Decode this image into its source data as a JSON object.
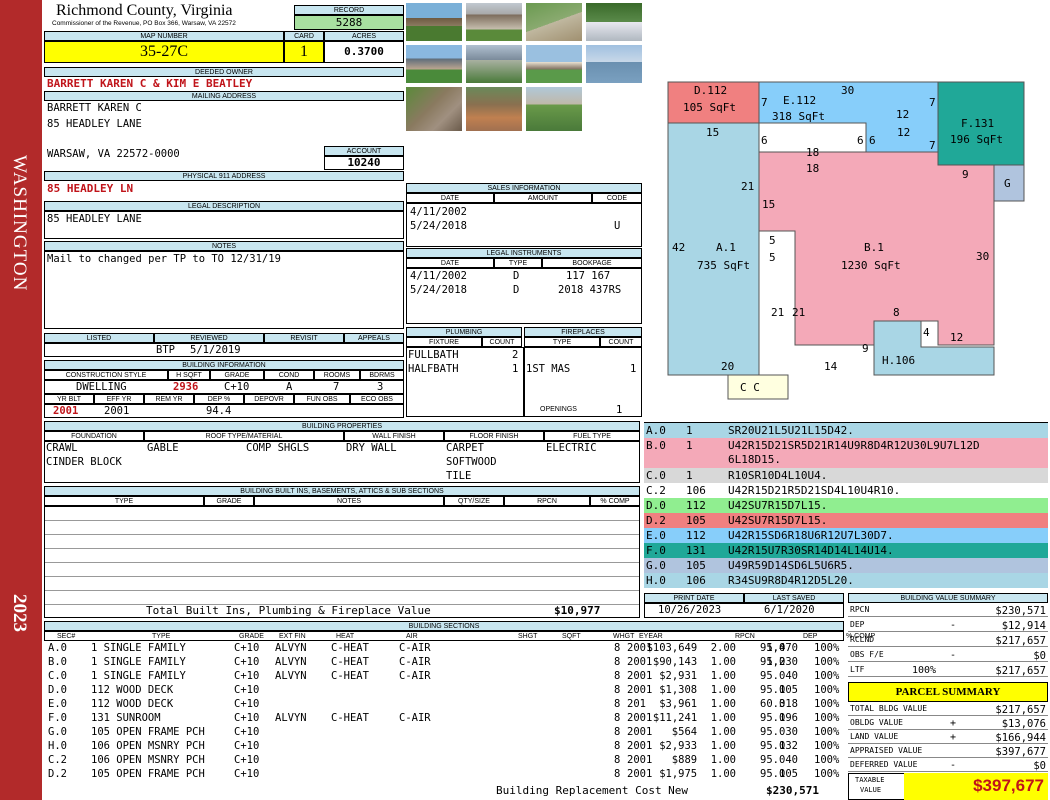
{
  "sidebar": {
    "top_label": "WASHINGTON",
    "bottom_label": "2023",
    "color": "#b22a2a"
  },
  "header": {
    "county": "Richmond County, Virginia",
    "commissioner": "Commissioner of the Revenue, PO Box 366, Warsaw, VA 22572",
    "record_label": "RECORD",
    "record": "5288",
    "map_number_label": "MAP NUMBER",
    "map_number": "35-27C",
    "card_label": "CARD",
    "card": "1",
    "acres_label": "ACRES",
    "acres": "0.3700"
  },
  "owner": {
    "deeded_owner_label": "DEEDED OWNER",
    "deeded_owner": "BARRETT KAREN C & KIM E BEATLEY",
    "mailing_label": "MAILING ADDRESS",
    "mail_line1": "BARRETT KAREN C",
    "mail_line2": "85 HEADLEY LANE",
    "mail_line3": "WARSAW, VA 22572-0000",
    "account_label": "ACCOUNT",
    "account": "10240",
    "physical_label": "PHYSICAL 911 ADDRESS",
    "physical": "85 HEADLEY LN",
    "legal_label": "LEGAL DESCRIPTION",
    "legal": "85 HEADLEY LANE",
    "notes_label": "NOTES",
    "notes": "Mail to changed per TP to TO 12/31/19"
  },
  "sales": {
    "title": "SALES INFORMATION",
    "col_date": "DATE",
    "col_amount": "AMOUNT",
    "col_code": "CODE",
    "rows": [
      {
        "date": "4/11/2002",
        "amount": "",
        "code": ""
      },
      {
        "date": "5/24/2018",
        "amount": "",
        "code": "U"
      }
    ]
  },
  "legal_instruments": {
    "title": "LEGAL INSTRUMENTS",
    "col_date": "DATE",
    "col_type": "TYPE",
    "col_book": "BOOKPAGE",
    "rows": [
      {
        "date": "4/11/2002",
        "type": "D",
        "book": "117 167"
      },
      {
        "date": "5/24/2018",
        "type": "D",
        "book": "2018 437RS"
      }
    ]
  },
  "plumbing": {
    "title": "PLUMBING",
    "col_fixture": "FIXTURE",
    "col_count": "COUNT",
    "rows": [
      {
        "fixture": "FULLBATH",
        "count": "2"
      },
      {
        "fixture": "HALFBATH",
        "count": "1"
      }
    ]
  },
  "fireplaces": {
    "title": "FIREPLACES",
    "col_type": "TYPE",
    "col_count": "COUNT",
    "rows": [
      {
        "type": "1ST MAS",
        "count": "1"
      }
    ],
    "openings_label": "OPENINGS",
    "openings": "1"
  },
  "review": {
    "listed_label": "LISTED",
    "reviewed_label": "REVIEWED",
    "revisit_label": "REVISIT",
    "appeals_label": "APPEALS",
    "listed": "",
    "reviewed_by": "BTP",
    "reviewed_date": "5/1/2019",
    "revisit": "",
    "appeals": ""
  },
  "building_info": {
    "title": "BUILDING INFORMATION",
    "labels": [
      "CONSTRUCTION STYLE",
      "H SQFT",
      "GRADE",
      "COND",
      "ROOMS",
      "BDRMS"
    ],
    "style": "DWELLING",
    "hsqft": "2936",
    "grade": "C+10",
    "cond": "A",
    "rooms": "7",
    "bdrms": "3",
    "labels2": [
      "YR BLT",
      "EFF YR",
      "REM YR",
      "DEP %",
      "DEPOVR",
      "FUN OBS",
      "ECO OBS"
    ],
    "yr_blt": "2001",
    "eff_yr": "2001",
    "rem_yr": "",
    "dep": "94.4",
    "depovr": "",
    "fun_obs": "",
    "eco_obs": ""
  },
  "properties": {
    "title": "BUILDING PROPERTIES",
    "labels": [
      "FOUNDATION",
      "ROOF TYPE/MATERIAL",
      "WALL FINISH",
      "FLOOR FINISH",
      "FUEL TYPE"
    ],
    "foundation": [
      "CRAWL",
      "CINDER BLOCK"
    ],
    "roof_type": "GABLE",
    "roof_material": "COMP SHGLS",
    "wall": "DRY WALL",
    "floor": [
      "CARPET",
      "SOFTWOOD",
      "TILE"
    ],
    "fuel": "ELECTRIC"
  },
  "builtins": {
    "title": "BUILDING BUILT INS, BASEMENTS, ATTICS & SUB SECTIONS",
    "labels": [
      "TYPE",
      "GRADE",
      "NOTES",
      "QTY/SIZE",
      "RPCN",
      "% COMP"
    ],
    "total_label": "Total Built Ins, Plumbing & Fireplace Value",
    "total": "$10,977"
  },
  "print": {
    "print_label": "PRINT DATE",
    "saved_label": "LAST SAVED",
    "print_date": "10/26/2023",
    "last_saved": "6/1/2020"
  },
  "sections": {
    "title": "BUILDING SECTIONS",
    "labels": [
      "SEC#",
      "TYPE",
      "GRADE",
      "EXT FIN",
      "HEAT",
      "AIR",
      "SHGT",
      "SQFT",
      "WHGT",
      "EYEAR",
      "RPCN",
      "DEP",
      "% COMP"
    ],
    "rows": [
      {
        "sec": "A.0",
        "type": "1 SINGLE FAMILY",
        "grade": "C+10",
        "ext": "ALVYN",
        "heat": "C-HEAT",
        "air": "C-AIR",
        "shgt": "2.00",
        "sqft": "1,470",
        "whgt": "8",
        "eyear": "2001",
        "rpcn": "$103,649",
        "dep": "95.0",
        "comp": "100%"
      },
      {
        "sec": "B.0",
        "type": "1 SINGLE FAMILY",
        "grade": "C+10",
        "ext": "ALVYN",
        "heat": "C-HEAT",
        "air": "C-AIR",
        "shgt": "1.00",
        "sqft": "1,230",
        "whgt": "8",
        "eyear": "2001",
        "rpcn": "$90,143",
        "dep": "95.0",
        "comp": "100%"
      },
      {
        "sec": "C.0",
        "type": "1 SINGLE FAMILY",
        "grade": "C+10",
        "ext": "ALVYN",
        "heat": "C-HEAT",
        "air": "C-AIR",
        "shgt": "1.00",
        "sqft": "40",
        "whgt": "8",
        "eyear": "2001",
        "rpcn": "$2,931",
        "dep": "95.0",
        "comp": "100%"
      },
      {
        "sec": "D.0",
        "type": "112 WOOD DECK",
        "grade": "C+10",
        "ext": "",
        "heat": "",
        "air": "",
        "shgt": "1.00",
        "sqft": "105",
        "whgt": "8",
        "eyear": "2001",
        "rpcn": "$1,308",
        "dep": "95.0",
        "comp": "100%"
      },
      {
        "sec": "E.0",
        "type": "112 WOOD DECK",
        "grade": "C+10",
        "ext": "",
        "heat": "",
        "air": "",
        "shgt": "1.00",
        "sqft": "318",
        "whgt": "8",
        "eyear": "201",
        "rpcn": "$3,961",
        "dep": "60.0",
        "comp": "100%"
      },
      {
        "sec": "F.0",
        "type": "131 SUNROOM",
        "grade": "C+10",
        "ext": "ALVYN",
        "heat": "C-HEAT",
        "air": "C-AIR",
        "shgt": "1.00",
        "sqft": "196",
        "whgt": "8",
        "eyear": "2001",
        "rpcn": "$11,241",
        "dep": "95.0",
        "comp": "100%"
      },
      {
        "sec": "G.0",
        "type": "105 OPEN FRAME PCH",
        "grade": "C+10",
        "ext": "",
        "heat": "",
        "air": "",
        "shgt": "1.00",
        "sqft": "30",
        "whgt": "8",
        "eyear": "2001",
        "rpcn": "$564",
        "dep": "95.0",
        "comp": "100%"
      },
      {
        "sec": "H.0",
        "type": "106 OPEN MSNRY PCH",
        "grade": "C+10",
        "ext": "",
        "heat": "",
        "air": "",
        "shgt": "1.00",
        "sqft": "132",
        "whgt": "8",
        "eyear": "2001",
        "rpcn": "$2,933",
        "dep": "95.0",
        "comp": "100%"
      },
      {
        "sec": "C.2",
        "type": "106 OPEN MSNRY PCH",
        "grade": "C+10",
        "ext": "",
        "heat": "",
        "air": "",
        "shgt": "1.00",
        "sqft": "40",
        "whgt": "8",
        "eyear": "2001",
        "rpcn": "$889",
        "dep": "95.0",
        "comp": "100%"
      },
      {
        "sec": "D.2",
        "type": "105 OPEN FRAME PCH",
        "grade": "C+10",
        "ext": "",
        "heat": "",
        "air": "",
        "shgt": "1.00",
        "sqft": "105",
        "whgt": "8",
        "eyear": "2001",
        "rpcn": "$1,975",
        "dep": "95.0",
        "comp": "100%"
      }
    ],
    "total_label": "Building Replacement Cost New",
    "total": "$230,571"
  },
  "sketch": {
    "labels": [
      {
        "id": "D.112",
        "sqft": "105 SqFt"
      },
      {
        "id": "E.112",
        "sqft": "318 SqFt"
      },
      {
        "id": "F.131",
        "sqft": "196 SqFt"
      },
      {
        "id": "G",
        "sqft": ""
      },
      {
        "id": "A.1",
        "sqft": "735 SqFt"
      },
      {
        "id": "B.1",
        "sqft": "1230 SqFt"
      },
      {
        "id": "H.106",
        "sqft": ""
      },
      {
        "id": "C C",
        "sqft": ""
      }
    ],
    "dims": [
      "7",
      "30",
      "12",
      "7",
      "15",
      "6",
      "18",
      "6",
      "6",
      "12",
      "7",
      "9",
      "18",
      "21",
      "15",
      "5",
      "5",
      "42",
      "30",
      "21",
      "21",
      "8",
      "4",
      "12",
      "9",
      "14",
      "20"
    ],
    "colors": {
      "A": "#a9d6e5",
      "B": "#f4a9b8",
      "D": "#f08080",
      "E": "#87cefa",
      "F": "#20a898",
      "G": "#b0c4de",
      "H": "#a9d6e5",
      "C": "#ffffe0"
    }
  },
  "legend": [
    {
      "code": "A.0",
      "n": "1",
      "desc": "SR20U21L5U21L15D42.",
      "desc2": "",
      "color": "#a9d6e5"
    },
    {
      "code": "B.0",
      "n": "1",
      "desc": "U42R15D21SR5D21R14U9R8D4R12U30L9U7L12D",
      "desc2": "6L18D15.",
      "color": "#f4a9b8"
    },
    {
      "code": "C.0",
      "n": "1",
      "desc": "R10SR10D4L10U4.",
      "desc2": "",
      "color": "#d8d8d8"
    },
    {
      "code": "C.2",
      "n": "106",
      "desc": "U42R15D21R5D21SD4L10U4R10.",
      "desc2": "",
      "color": "#ffffff"
    },
    {
      "code": "D.0",
      "n": "112",
      "desc": "U42SU7R15D7L15.",
      "desc2": "",
      "color": "#90ee90"
    },
    {
      "code": "D.2",
      "n": "105",
      "desc": "U42SU7R15D7L15.",
      "desc2": "",
      "color": "#f08080"
    },
    {
      "code": "E.0",
      "n": "112",
      "desc": "U42R15SD6R18U6R12U7L30D7.",
      "desc2": "",
      "color": "#87cefa"
    },
    {
      "code": "F.0",
      "n": "131",
      "desc": "U42R15U7R30SR14D14L14U14.",
      "desc2": "",
      "color": "#20a898"
    },
    {
      "code": "G.0",
      "n": "105",
      "desc": "U49R59D14SD6L5U6R5.",
      "desc2": "",
      "color": "#b0c4de"
    },
    {
      "code": "H.0",
      "n": "106",
      "desc": "R34SU9R8D4R12D5L20.",
      "desc2": "",
      "color": "#a9d6e5"
    }
  ],
  "value_summary": {
    "title": "BUILDING VALUE SUMMARY",
    "rows": [
      {
        "label": "RPCN",
        "sign": "",
        "value": "$230,571"
      },
      {
        "label": "DEP",
        "sign": "-",
        "value": "$12,914"
      },
      {
        "label": "RCLND",
        "sign": "",
        "value": "$217,657"
      },
      {
        "label": "OBS F/E",
        "sign": "-",
        "value": "$0"
      },
      {
        "label": "LTF",
        "sign": "100%",
        "value": "$217,657"
      }
    ]
  },
  "parcel": {
    "title": "PARCEL SUMMARY",
    "rows": [
      {
        "label": "TOTAL BLDG VALUE",
        "sign": "",
        "value": "$217,657"
      },
      {
        "label": "OBLDG VALUE",
        "sign": "+",
        "value": "$13,076"
      },
      {
        "label": "LAND VALUE",
        "sign": "+",
        "value": "$166,944"
      },
      {
        "label": "APPRAISED VALUE",
        "sign": "",
        "value": "$397,677"
      },
      {
        "label": "DEFERRED VALUE",
        "sign": "-",
        "value": "$0"
      }
    ],
    "taxable_label1": "TAXABLE",
    "taxable_label2": "VALUE",
    "taxable": "$397,677",
    "accent": "#ffff00"
  }
}
